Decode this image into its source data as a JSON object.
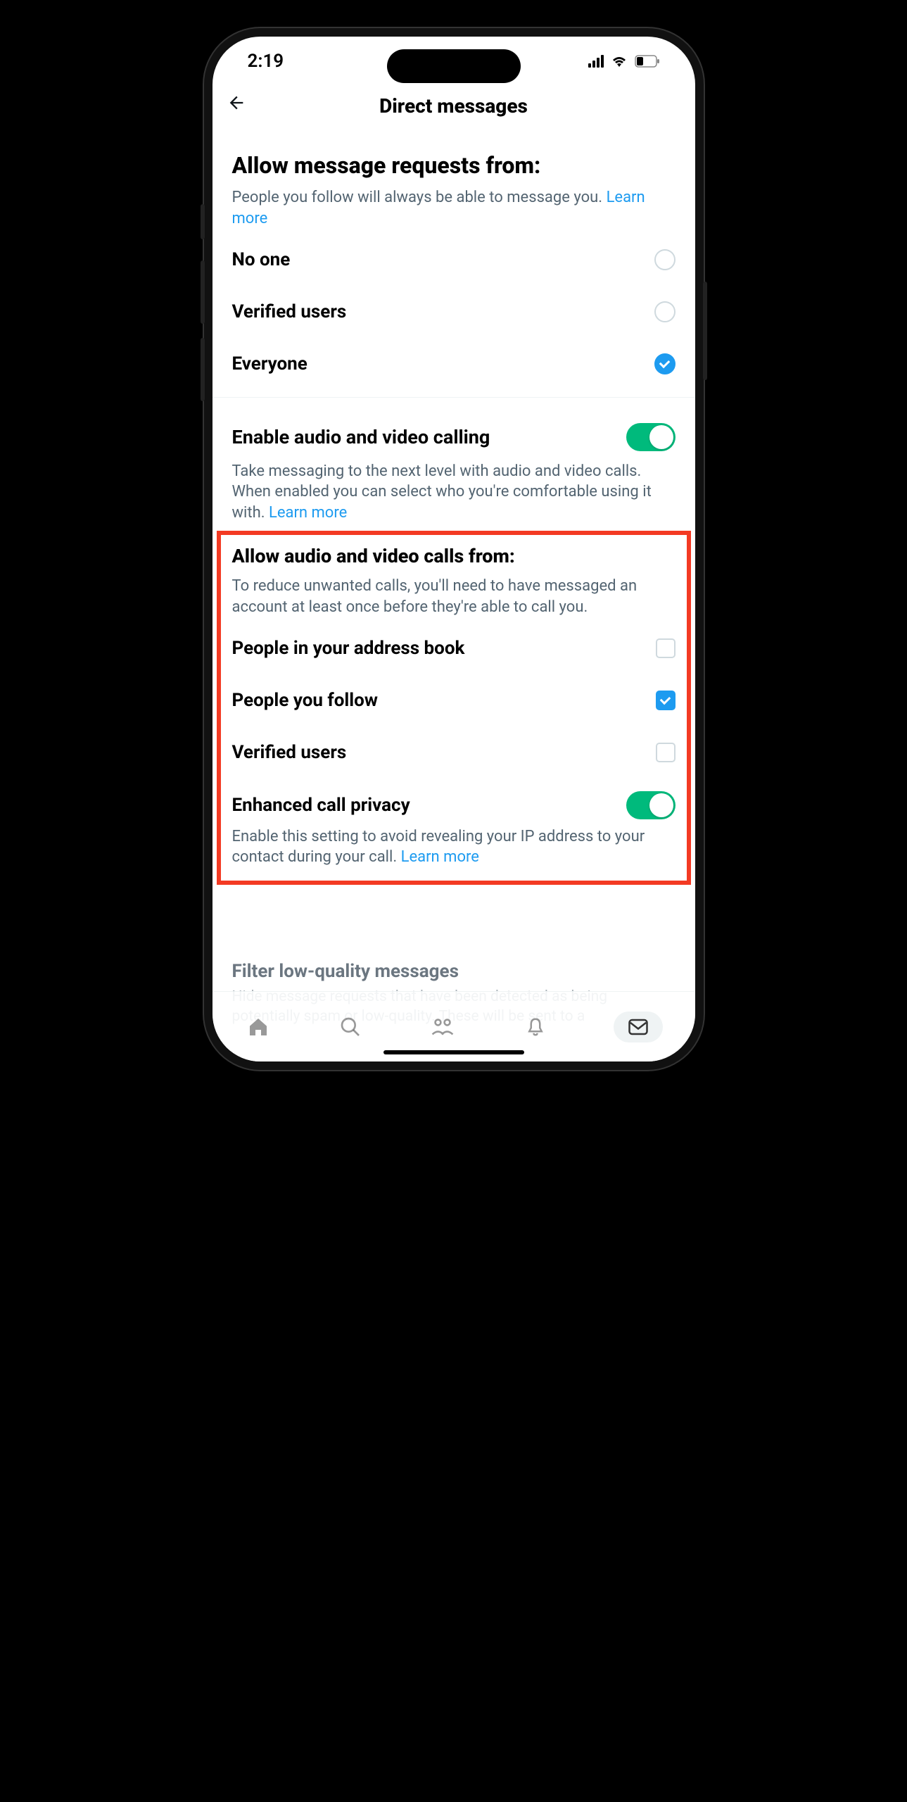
{
  "status": {
    "time": "2:19"
  },
  "header": {
    "title": "Direct messages"
  },
  "section1": {
    "title": "Allow message requests from:",
    "subtitle": "People you follow will always be able to message you. ",
    "learn_more": "Learn more",
    "options": [
      {
        "label": "No one",
        "selected": false
      },
      {
        "label": "Verified users",
        "selected": false
      },
      {
        "label": "Everyone",
        "selected": true
      }
    ]
  },
  "section2": {
    "title": "Enable audio and video calling",
    "enabled": true,
    "subtitle": "Take messaging to the next level with audio and video calls. When enabled you can select who you're comfortable using it with. ",
    "learn_more": "Learn more"
  },
  "section3": {
    "title": "Allow audio and video calls from:",
    "subtitle": "To reduce unwanted calls, you'll need to have messaged an account at least once before they're able to call you.",
    "options": [
      {
        "label": "People in your address book",
        "checked": false
      },
      {
        "label": "People you follow",
        "checked": true
      },
      {
        "label": "Verified users",
        "checked": false
      }
    ],
    "privacy_title": "Enhanced call privacy",
    "privacy_enabled": true,
    "privacy_sub": "Enable this setting to avoid revealing your IP address to your contact during your call. ",
    "privacy_learn_more": "Learn more"
  },
  "section4": {
    "title": "Filter low-quality messages",
    "subtitle": "Hide message requests that have been detected as being potentially spam or low-quality. These will be sent to a"
  }
}
